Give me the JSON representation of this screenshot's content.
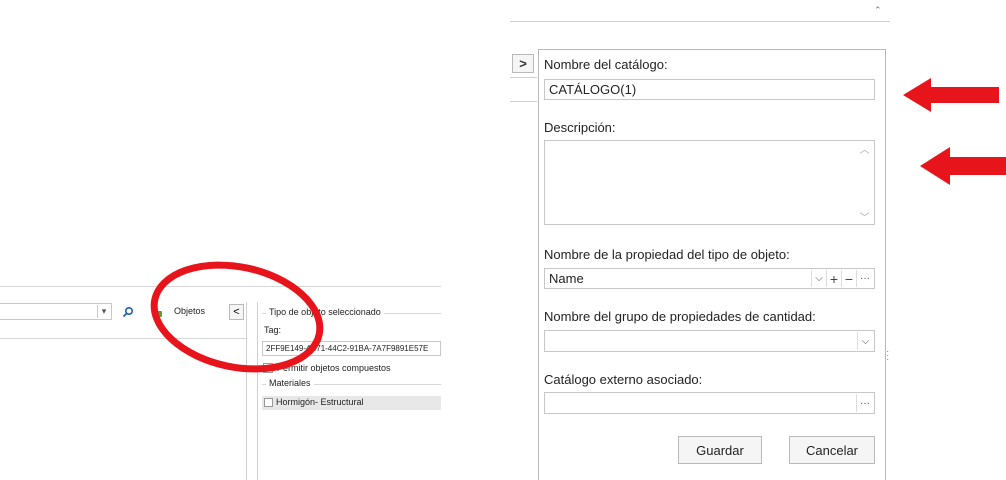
{
  "left_panel": {
    "objects_label": "Objetos",
    "collapse_glyph": "<",
    "search_icon": "search-icon",
    "section_title": "Tipo de objeto seleccionado",
    "tag_label": "Tag:",
    "tag_value": "2FF9E149-4C71-44C2-91BA-7A7F9891E57E",
    "composite_label": "Permitir objetos compuestos",
    "materials_title": "Materiales",
    "material_item": "Hormigón- Estructural"
  },
  "right_panel": {
    "expand_glyph": ">",
    "catalog_name_label": "Nombre del catálogo:",
    "catalog_name_value": "CATÁLOGO(1)",
    "description_label": "Descripción:",
    "description_value": "",
    "property_name_label": "Nombre de la propiedad del tipo de objeto:",
    "property_name_value": "Name",
    "quantity_group_label": "Nombre del grupo de propiedades de cantidad:",
    "quantity_group_value": "",
    "external_catalog_label": "Catálogo externo asociado:",
    "external_catalog_value": "",
    "save_label": "Guardar",
    "cancel_label": "Cancelar"
  },
  "annotations": {
    "color": "#e8141b"
  }
}
